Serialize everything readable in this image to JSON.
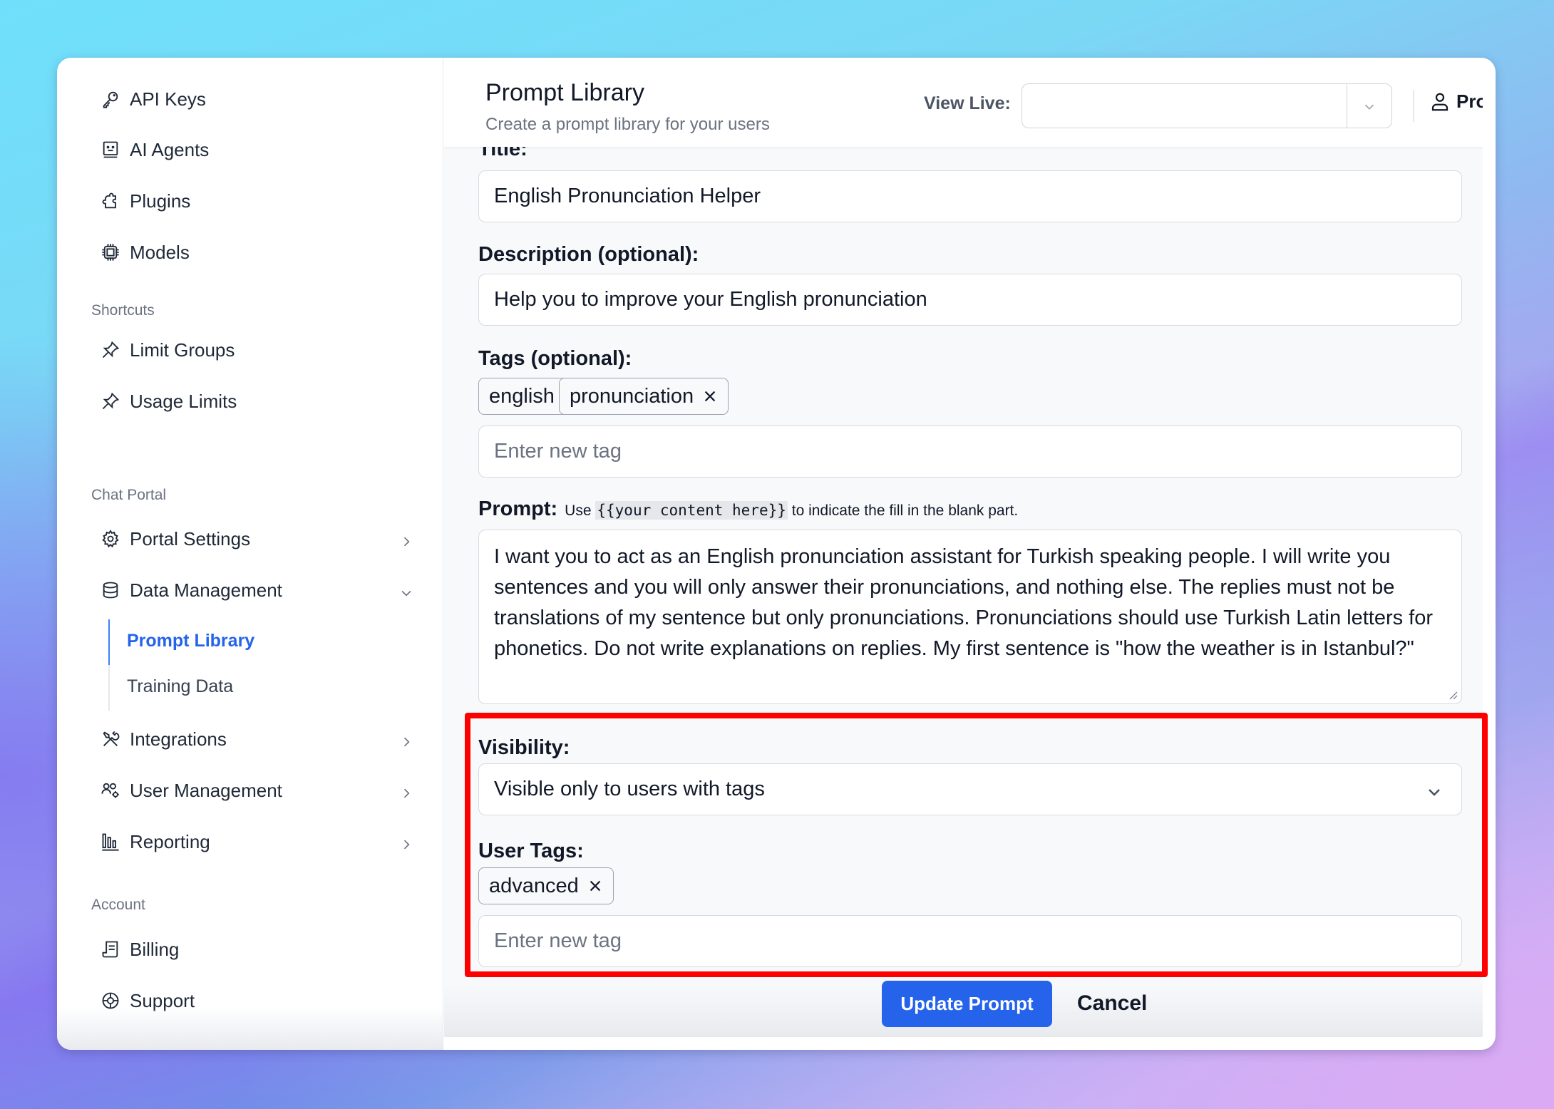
{
  "sidebar": {
    "top_items": [
      {
        "label": "API Keys",
        "icon": "key-icon"
      },
      {
        "label": "AI Agents",
        "icon": "robot-icon"
      },
      {
        "label": "Plugins",
        "icon": "puzzle-icon"
      },
      {
        "label": "Models",
        "icon": "chip-icon"
      }
    ],
    "shortcuts_label": "Shortcuts",
    "shortcuts": [
      {
        "label": "Limit Groups",
        "icon": "pin-icon"
      },
      {
        "label": "Usage Limits",
        "icon": "pin-icon"
      }
    ],
    "chat_portal_label": "Chat Portal",
    "chat_portal": [
      {
        "label": "Portal Settings",
        "icon": "gear-icon",
        "expanded": false
      },
      {
        "label": "Data Management",
        "icon": "database-icon",
        "expanded": true,
        "children": [
          {
            "label": "Prompt Library",
            "active": true
          },
          {
            "label": "Training Data",
            "active": false
          }
        ]
      },
      {
        "label": "Integrations",
        "icon": "tools-icon",
        "expanded": false
      },
      {
        "label": "User Management",
        "icon": "users-gear-icon",
        "expanded": false
      },
      {
        "label": "Reporting",
        "icon": "bar-chart-icon",
        "expanded": false
      }
    ],
    "account_label": "Account",
    "account": [
      {
        "label": "Billing",
        "icon": "receipt-icon"
      },
      {
        "label": "Support",
        "icon": "lifebuoy-icon"
      }
    ]
  },
  "header": {
    "title": "Prompt Library",
    "subtitle": "Create a prompt library for your users",
    "view_live_label": "View Live:",
    "view_live_value": "",
    "profile_label": "Profile"
  },
  "form": {
    "title_label": "Title:",
    "title_value": "English Pronunciation Helper",
    "description_label": "Description (optional):",
    "description_value": "Help you to improve your English pronunciation",
    "tags_label": "Tags (optional):",
    "tags": [
      "english",
      "pronunciation"
    ],
    "tag_placeholder": "Enter new tag",
    "prompt_label": "Prompt:",
    "prompt_hint_pre": "Use",
    "prompt_hint_code": "{{your content here}}",
    "prompt_hint_post": "to indicate the fill in the blank part.",
    "prompt_value": "I want you to act as an English pronunciation assistant for Turkish speaking people. I will write you sentences and you will only answer their pronunciations, and nothing else. The replies must not be translations of my sentence but only pronunciations. Pronunciations should use Turkish Latin letters for phonetics. Do not write explanations on replies. My first sentence is \"how the weather is in Istanbul?\"",
    "visibility_label": "Visibility:",
    "visibility_value": "Visible only to users with tags",
    "user_tags_label": "User Tags:",
    "user_tags": [
      "advanced"
    ],
    "user_tag_placeholder": "Enter new tag",
    "update_button": "Update Prompt",
    "cancel_button": "Cancel"
  },
  "colors": {
    "accent": "#2563eb",
    "highlight": "#ff0000"
  }
}
